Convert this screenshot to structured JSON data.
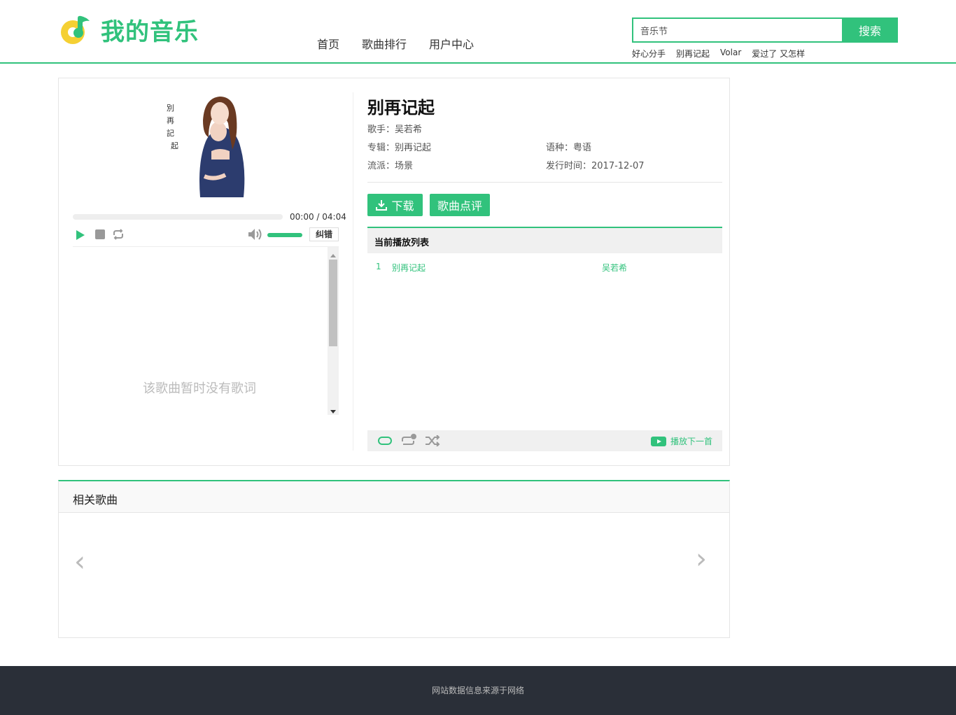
{
  "brand": {
    "name": "我的音乐"
  },
  "nav": [
    "首页",
    "歌曲排行",
    "用户中心"
  ],
  "search": {
    "value": "音乐节",
    "button": "搜索"
  },
  "hot_searches": [
    "好心分手",
    "别再记起",
    "Volar",
    "爱过了 又怎样"
  ],
  "cover": {
    "vertical_text": [
      "別",
      "再",
      "記",
      "起"
    ]
  },
  "player": {
    "current_time": "00:00",
    "total_time": "04:04",
    "progress": 0,
    "volume": 1.0,
    "fix_label": "纠错",
    "lyrics_empty": "该歌曲暂时没有歌词"
  },
  "song": {
    "title": "别再记起",
    "singer_label": "歌手：",
    "singer": "吴若希",
    "album_label": "专辑：",
    "album": "别再记起",
    "lang_label": "语种：",
    "lang": "粤语",
    "genre_label": "流派：",
    "genre": "场景",
    "date_label": "发行时间：",
    "date": "2017-12-07"
  },
  "actions": {
    "download": "下载",
    "comment": "歌曲点评"
  },
  "playlist": {
    "title": "当前播放列表",
    "items": [
      {
        "index": "1",
        "name": "别再记起",
        "artist": "吴若希"
      }
    ],
    "next_label": "播放下一首"
  },
  "related": {
    "title": "相关歌曲",
    "prev": "‹",
    "next": "›"
  },
  "footer": {
    "text": "网站数据信息来源于网络"
  },
  "colors": {
    "accent": "#31c27c",
    "logo_yellow": "#f5d033",
    "footer_bg": "#2a2f38"
  }
}
